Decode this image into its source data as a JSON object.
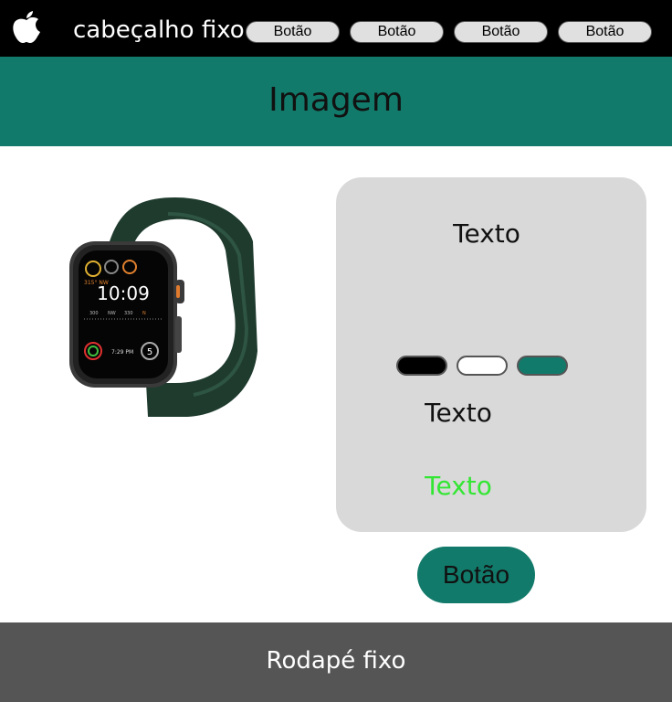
{
  "header": {
    "logo_icon": "apple-logo-icon",
    "title": "cabeçalho fixo",
    "nav_buttons": [
      {
        "label": "Botão"
      },
      {
        "label": "Botão"
      },
      {
        "label": "Botão"
      },
      {
        "label": "Botão"
      }
    ]
  },
  "banner": {
    "text": "Imagem",
    "color": "#127a6a"
  },
  "product": {
    "image_icon": "smartwatch-icon",
    "watch_face": {
      "time": "10:09",
      "heading": "315° NW",
      "bottom_values": [
        "7:29 PM",
        "5"
      ],
      "scale_labels": [
        "300",
        "NW",
        "330",
        "N"
      ]
    }
  },
  "card": {
    "title": "Texto",
    "color_options": [
      {
        "name": "black",
        "color": "#000000"
      },
      {
        "name": "white",
        "color": "#ffffff"
      },
      {
        "name": "green",
        "color": "#127a6a"
      }
    ],
    "text_secondary": "Texto",
    "text_highlight": "Texto",
    "highlight_color": "#33e633"
  },
  "main_button": {
    "label": "Botão"
  },
  "footer": {
    "text": "Rodapé fixo"
  }
}
